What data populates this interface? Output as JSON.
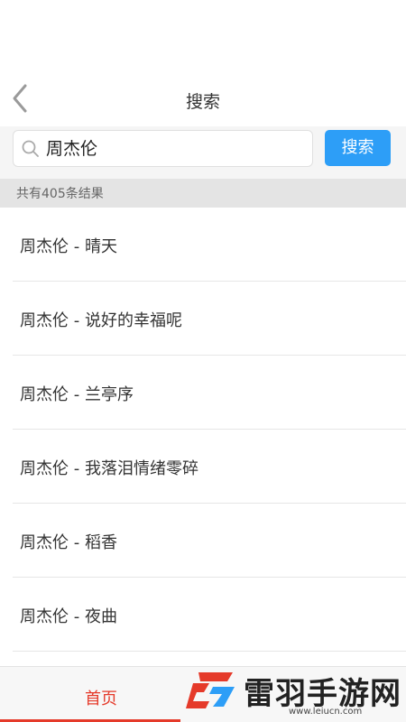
{
  "header": {
    "title": "搜索",
    "back_icon": "chevron-left-icon"
  },
  "search": {
    "value": "周杰伦",
    "button_label": "搜索",
    "icon": "search-icon",
    "button_color": "#2d9ef7"
  },
  "results": {
    "count_text": "共有405条结果",
    "items": [
      "周杰伦 - 晴天",
      "周杰伦 - 说好的幸福呢",
      "周杰伦 - 兰亭序",
      "周杰伦 - 我落泪情绪零碎",
      "周杰伦 - 稻香",
      "周杰伦 - 夜曲"
    ]
  },
  "tabbar": {
    "home_label": "首页",
    "active_color": "#e53a2a"
  },
  "watermark": {
    "name": "雷羽手游网",
    "url": "www.leiucn.com"
  }
}
